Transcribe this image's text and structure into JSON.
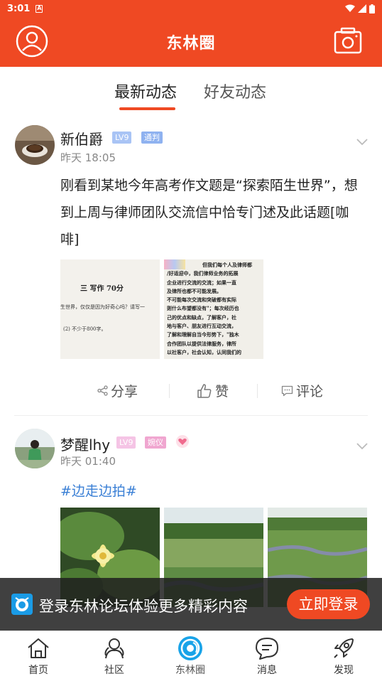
{
  "status": {
    "time": "3:01",
    "a_icon": "A"
  },
  "header": {
    "title": "东林圈"
  },
  "tabs": [
    {
      "label": "最新动态"
    },
    {
      "label": "好友动态"
    }
  ],
  "posts": [
    {
      "user": "新伯爵",
      "level": "LV9",
      "role": "通判",
      "time": "昨天 18:05",
      "text": "刚看到某地今年高考作文题是“探索陌生世界”，想到上周与律师团队交流信中恰专门述及此话题[咖啡]",
      "image1_heading": "三  写作  70分",
      "image1_line1": "生世界，仅仅是因为好奇心吗？请写一",
      "image1_line2": "(2) 不少于800字。",
      "image2_lines": [
        "但我们每个人及律师都",
        "/好适迎中，我们律师业务的拓展",
        "企业进行交流的交流；如果一直",
        "及律所也都不可能发展。",
        "不可能每次交流和突破都有实际",
        "则什么布望都没有\"；每次经历也",
        "己的优点和缺点，了解客户，社",
        "地与客户、朋友进行互动交流，",
        "了解和理解自当今形势下，\"独木",
        "合作团队以提供法律服务，律所",
        "以社客户，社会认知，认同我们的"
      ],
      "actions": {
        "share": "分享",
        "like": "赞",
        "comment": "评论"
      }
    },
    {
      "user": "梦醒lhy",
      "level": "LV9",
      "role": "婉仪",
      "time": "昨天 01:40",
      "topic": "#边走边拍#"
    }
  ],
  "login_banner": {
    "message": "登录东林论坛体验更多精彩内容",
    "button": "立即登录"
  },
  "bottom_nav": [
    {
      "label": "首页",
      "icon": "home-icon"
    },
    {
      "label": "社区",
      "icon": "community-icon"
    },
    {
      "label": "东林圈",
      "icon": "donglin-circle-icon",
      "active": true
    },
    {
      "label": "消息",
      "icon": "message-icon"
    },
    {
      "label": "发现",
      "icon": "rocket-icon"
    }
  ],
  "colors": {
    "brand": "#ef4923",
    "level_badge": "#a9c4f5",
    "role_badge_blue": "#8fb2f0",
    "role_badge_pink": "#f0a6d0",
    "active_nav": "#19a3e8"
  }
}
